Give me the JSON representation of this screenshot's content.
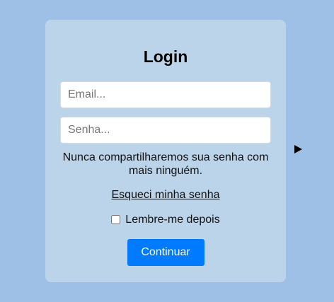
{
  "login": {
    "title": "Login",
    "email_placeholder": "Email...",
    "password_placeholder": "Senha...",
    "privacy_hint": "Nunca compartilharemos sua senha com mais ninguém.",
    "forgot_password": "Esqueci minha senha",
    "remember_me": "Lembre-me depois",
    "remember_me_checked": false,
    "submit_label": "Continuar"
  },
  "side_icon": "play-triangle-icon",
  "colors": {
    "page_background": "#9ec0e6",
    "card_background": "#bcd4ea",
    "primary_button": "#007bff"
  }
}
